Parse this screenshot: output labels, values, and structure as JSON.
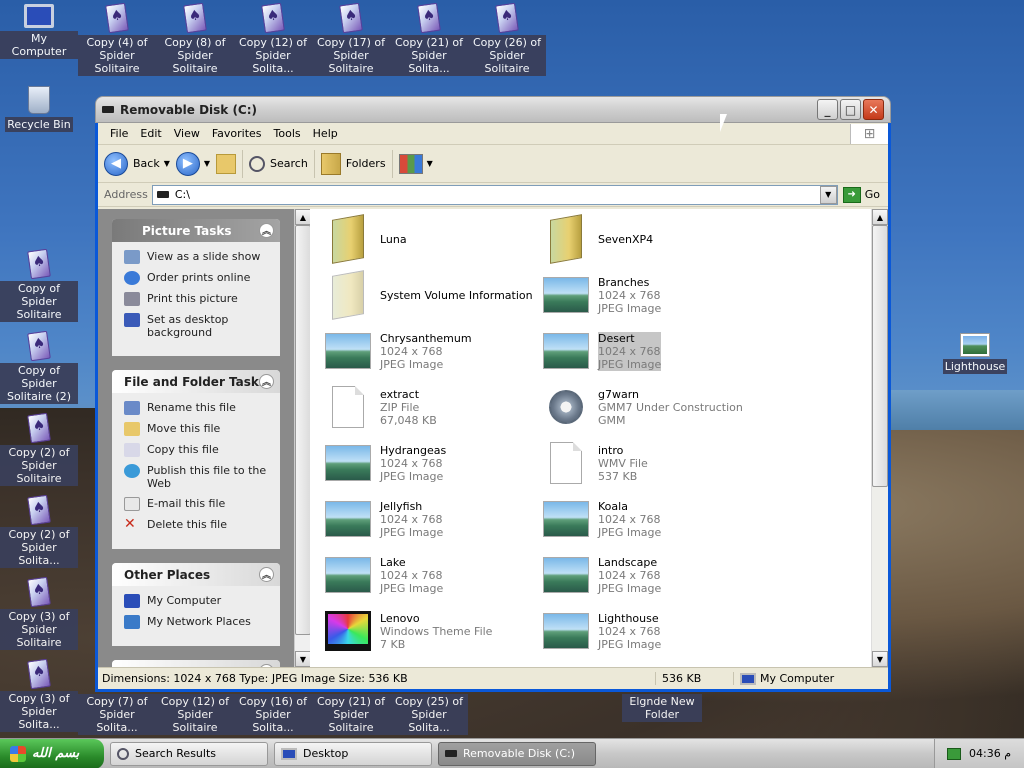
{
  "desktop": {
    "top_icons": [
      {
        "label": "My Computer"
      },
      {
        "label": "Copy (4) of Spider Solitaire"
      },
      {
        "label": "Copy (8) of Spider Solitaire"
      },
      {
        "label": "Copy (12) of Spider Solita..."
      },
      {
        "label": "Copy (17) of Spider Solitaire"
      },
      {
        "label": "Copy (21) of Spider Solita..."
      },
      {
        "label": "Copy (26) of Spider Solitaire"
      }
    ],
    "left_icons": [
      {
        "label": "Recycle Bin"
      },
      {
        "label": "Copy of Spider Solitaire"
      },
      {
        "label": "Copy of Spider Solitaire (2)"
      },
      {
        "label": "Copy (2) of Spider Solitaire"
      },
      {
        "label": "Copy (2) of Spider Solita..."
      },
      {
        "label": "Copy (3) of Spider Solitaire"
      },
      {
        "label": "Copy (3) of Spider Solita..."
      }
    ],
    "bottom_icons": [
      {
        "label": "Copy (7) of Spider Solita..."
      },
      {
        "label": "Copy (12) of Spider Solitaire"
      },
      {
        "label": "Copy (16) of Spider Solita..."
      },
      {
        "label": "Copy (21) of Spider Solitaire"
      },
      {
        "label": "Copy (25) of Spider Solita..."
      },
      {
        "label": "Elgnde New Folder"
      }
    ],
    "right_icon": {
      "label": "Lighthouse"
    }
  },
  "window": {
    "title": "Removable Disk (C:)",
    "menu": [
      "File",
      "Edit",
      "View",
      "Favorites",
      "Tools",
      "Help"
    ],
    "toolbar": {
      "back": "Back",
      "search": "Search",
      "folders": "Folders"
    },
    "address": {
      "label": "Address",
      "value": "C:\\",
      "go": "Go"
    },
    "picture_tasks": {
      "title": "Picture Tasks",
      "items": [
        "View as a slide show",
        "Order prints online",
        "Print this picture",
        "Set as desktop background"
      ]
    },
    "file_tasks": {
      "title": "File and Folder Tasks",
      "items": [
        "Rename this file",
        "Move this file",
        "Copy this file",
        "Publish this file to the Web",
        "E-mail this file",
        "Delete this file"
      ]
    },
    "other_places": {
      "title": "Other Places",
      "items": [
        "My Computer",
        "My Network Places"
      ]
    },
    "files": [
      {
        "name": "Luna",
        "l2": "",
        "l3": "",
        "icon": "folder"
      },
      {
        "name": "SevenXP4",
        "l2": "",
        "l3": "",
        "icon": "folder"
      },
      {
        "name": "System Volume Information",
        "l2": "",
        "l3": "",
        "icon": "folder-pale"
      },
      {
        "name": "Branches",
        "l2": "1024 x 768",
        "l3": "JPEG Image",
        "icon": "image"
      },
      {
        "name": "Chrysanthemum",
        "l2": "1024 x 768",
        "l3": "JPEG Image",
        "icon": "image"
      },
      {
        "name": "Desert",
        "l2": "1024 x 768",
        "l3": "JPEG Image",
        "icon": "image",
        "selected": true
      },
      {
        "name": "extract",
        "l2": "ZIP File",
        "l3": "67,048 KB",
        "icon": "doc"
      },
      {
        "name": "g7warn",
        "l2": "GMM7 Under Construction",
        "l3": "GMM",
        "icon": "gear"
      },
      {
        "name": "Hydrangeas",
        "l2": "1024 x 768",
        "l3": "JPEG Image",
        "icon": "image"
      },
      {
        "name": "intro",
        "l2": "WMV File",
        "l3": "537 KB",
        "icon": "doc"
      },
      {
        "name": "Jellyfish",
        "l2": "1024 x 768",
        "l3": "JPEG Image",
        "icon": "image"
      },
      {
        "name": "Koala",
        "l2": "1024 x 768",
        "l3": "JPEG Image",
        "icon": "image"
      },
      {
        "name": "Lake",
        "l2": "1024 x 768",
        "l3": "JPEG Image",
        "icon": "image"
      },
      {
        "name": "Landscape",
        "l2": "1024 x 768",
        "l3": "JPEG Image",
        "icon": "image"
      },
      {
        "name": "Lenovo",
        "l2": "Windows Theme File",
        "l3": "7 KB",
        "icon": "theme"
      },
      {
        "name": "Lighthouse",
        "l2": "1024 x 768",
        "l3": "JPEG Image",
        "icon": "image"
      }
    ],
    "status": {
      "details": "Dimensions: 1024 x 768 Type: JPEG Image Size: 536 KB",
      "size": "536 KB",
      "zone": "My Computer"
    }
  },
  "taskbar": {
    "start_label": "بسم الله",
    "tasks": [
      "Search Results",
      "Desktop",
      "Removable Disk (C:)"
    ],
    "clock": "04:36 م"
  }
}
